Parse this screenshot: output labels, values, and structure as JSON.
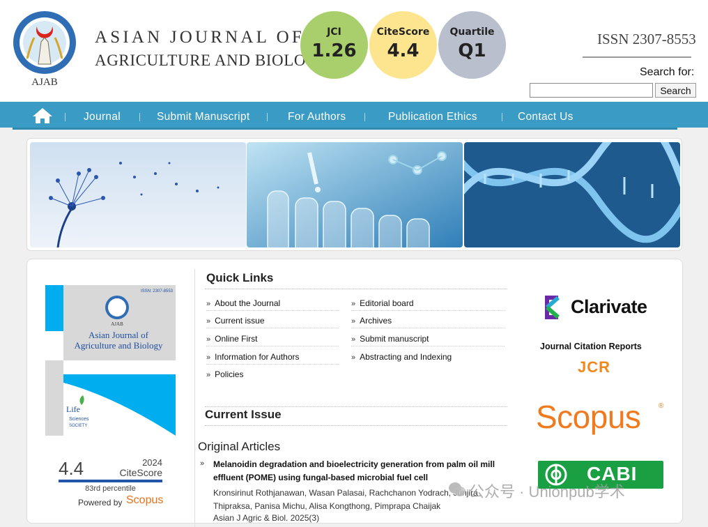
{
  "header": {
    "logo_text": "AJAB",
    "title_line1": "ASIAN JOURNAL OF",
    "title_line2": "AGRICULTURE AND BIOLOGY",
    "issn": "ISSN 2307-8553",
    "metrics": [
      {
        "label": "JCI",
        "value": "1.26",
        "color": "#a9cf6c"
      },
      {
        "label": "CiteScore",
        "value": "4.4",
        "color": "#fde58f"
      },
      {
        "label": "Quartile",
        "value": "Q1",
        "color": "#b9bfcd"
      }
    ]
  },
  "search": {
    "label": "Search for:",
    "value": "",
    "button": "Search"
  },
  "nav": {
    "home_icon": "home-icon",
    "items": [
      "Journal",
      "Submit Manuscript",
      "For Authors",
      "Publication Ethics",
      "Contact Us"
    ],
    "bg_color": "#3a9cc4"
  },
  "cover": {
    "issn": "ISSN: 2307-8553",
    "logo_text": "AJAB",
    "title_line1": "Asian Journal of",
    "title_line2": "Agriculture and Biology",
    "society_line1": "Life",
    "society_line2": "Sciences",
    "society_line3": "SOCIETY"
  },
  "citescore": {
    "value": "4.4",
    "year": "2024",
    "label": "CiteScore",
    "percentile": "83rd percentile",
    "powered_by": "Powered by",
    "provider": "Scopus"
  },
  "quick_links": {
    "title": "Quick Links",
    "left": [
      "About the Journal",
      "Current issue",
      "Online First",
      "Information for Authors",
      "Policies"
    ],
    "right": [
      "Editorial board",
      "Archives",
      "Submit manuscript",
      "Abstracting and Indexing"
    ]
  },
  "current_issue": {
    "title": "Current Issue",
    "section": "Original Articles",
    "article": {
      "title": "Melanoidin degradation and bioelectricity generation from palm oil mill effluent (POME) using fungal-based microbial fuel cell",
      "authors": "Kronsirinut Rothjanawan, Wasan Palasai, Rachchanon Yodrach, Junjira Thipraksa, Panisa Michu, Alisa Kongthong, Pimprapa Chaijak",
      "citation": "Asian J Agric & Biol. 2025(3)"
    }
  },
  "indexing": {
    "clarivate": "Clarivate",
    "jcr_title": "Journal Citation Reports",
    "jcr": "JCR",
    "scopus": "Scopus",
    "scopus_reg": "®",
    "cabi": "CABI"
  },
  "watermark": "公众号 · Unionpub学术"
}
